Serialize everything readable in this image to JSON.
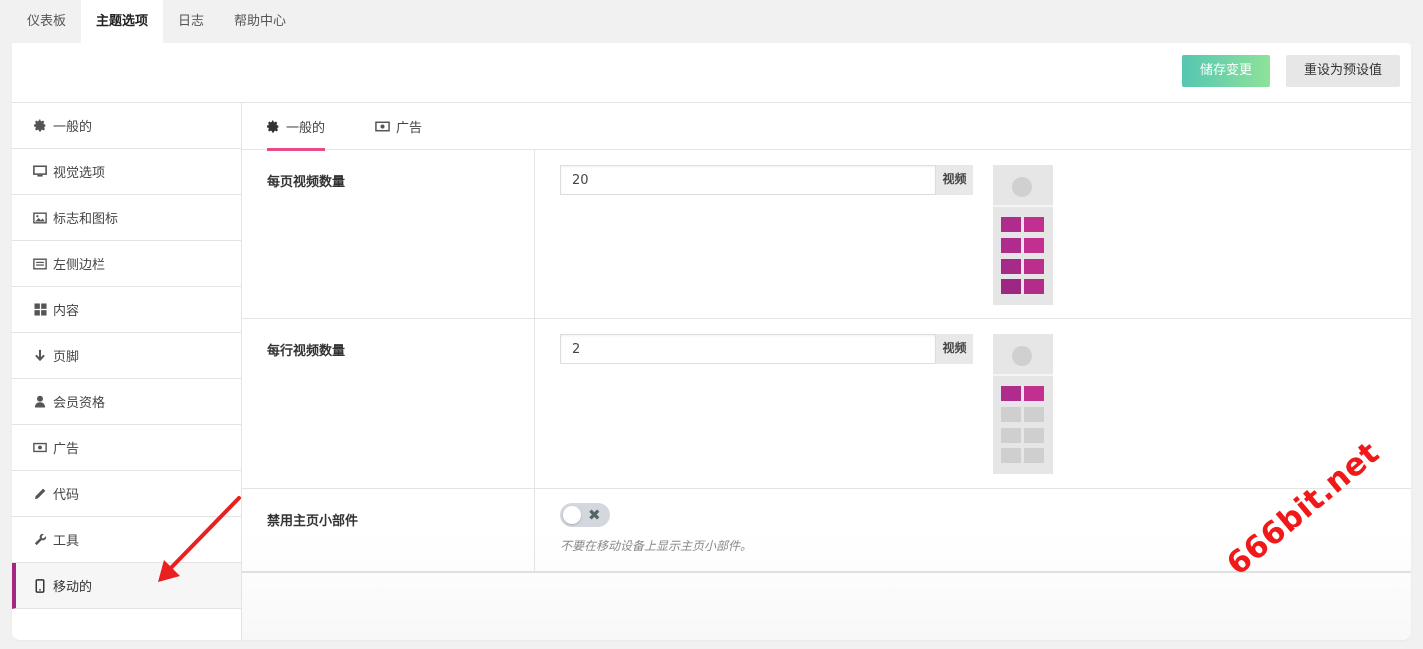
{
  "top_tabs": [
    {
      "label": "仪表板",
      "active": false
    },
    {
      "label": "主题选项",
      "active": true
    },
    {
      "label": "日志",
      "active": false
    },
    {
      "label": "帮助中心",
      "active": false
    }
  ],
  "header": {
    "save_label": "储存变更",
    "reset_label": "重设为预设值"
  },
  "sidebar": {
    "items": [
      {
        "label": "一般的",
        "icon": "gear-icon"
      },
      {
        "label": "视觉选项",
        "icon": "desktop-icon"
      },
      {
        "label": "标志和图标",
        "icon": "image-icon"
      },
      {
        "label": "左侧边栏",
        "icon": "list-icon"
      },
      {
        "label": "内容",
        "icon": "grid-icon"
      },
      {
        "label": "页脚",
        "icon": "arrow-down-icon"
      },
      {
        "label": "会员资格",
        "icon": "user-icon"
      },
      {
        "label": "广告",
        "icon": "money-icon"
      },
      {
        "label": "代码",
        "icon": "pencil-icon"
      },
      {
        "label": "工具",
        "icon": "wrench-icon"
      },
      {
        "label": "移动的",
        "icon": "mobile-icon",
        "active": true
      }
    ]
  },
  "sub_tabs": [
    {
      "label": "一般的",
      "icon": "gear-icon",
      "active": true
    },
    {
      "label": "广告",
      "icon": "money-icon",
      "active": false
    }
  ],
  "settings": {
    "videos_per_page": {
      "label": "每页视频数量",
      "value": "20",
      "addon": "视频"
    },
    "videos_per_row": {
      "label": "每行视频数量",
      "value": "2",
      "addon": "视频"
    },
    "disable_homepage_widgets": {
      "label": "禁用主页小部件",
      "enabled": false,
      "hint": "不要在移动设备上显示主页小部件。"
    }
  },
  "watermark": "666bit.net",
  "colors": {
    "accent": "#a4287f",
    "tab_underline": "#e64c8a",
    "save_gradient_start": "#56c6b2",
    "save_gradient_end": "#8ee29a",
    "annotation": "#e82020"
  }
}
